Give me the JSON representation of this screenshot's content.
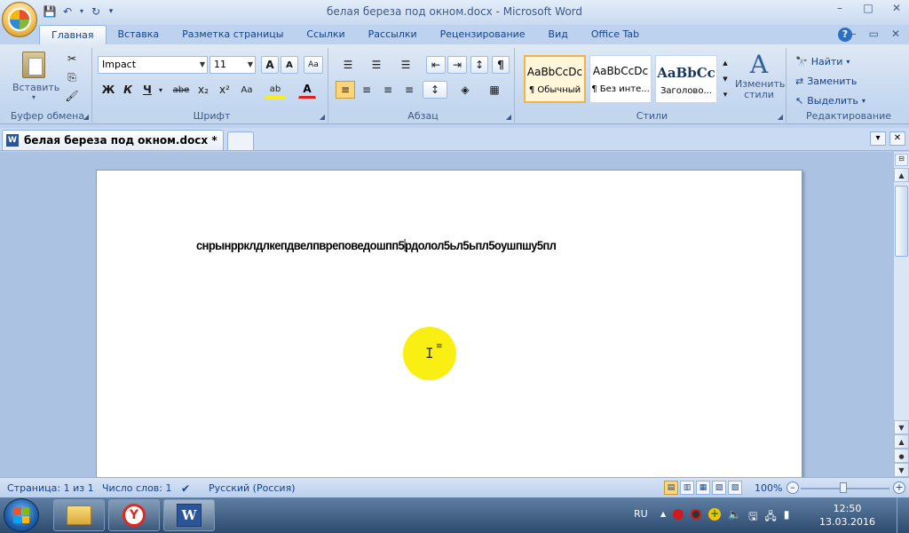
{
  "window": {
    "title": "белая береза под окном.docx - Microsoft Word",
    "controls": {
      "minimize": "–",
      "maximize": "□",
      "close": "✕"
    }
  },
  "qat": {
    "save_icon": "💾",
    "undo_icon": "↶",
    "undo_arrow": "▾",
    "redo_icon": "↻",
    "customize": "▾"
  },
  "ribbon": {
    "tabs": [
      "Главная",
      "Вставка",
      "Разметка страницы",
      "Ссылки",
      "Рассылки",
      "Рецензирование",
      "Вид",
      "Office Tab"
    ],
    "help": "?",
    "minimize_controls": {
      "min": "–",
      "restore": "▭",
      "close": "✕"
    },
    "clipboard": {
      "label": "Буфер обмена",
      "paste": "Вставить",
      "paste_arrow": "▾",
      "cut_icon": "✂",
      "copy_icon": "⎘",
      "format_painter_icon": "🖌"
    },
    "font": {
      "label": "Шрифт",
      "font_name": "Impact",
      "font_size": "11",
      "grow": "A",
      "shrink": "A",
      "clear": "Aa",
      "bold": "Ж",
      "italic": "К",
      "underline": "Ч",
      "underline_arrow": "▾",
      "strike": "abe",
      "subscript": "x₂",
      "superscript": "x²",
      "case": "Aa",
      "highlight": "ab",
      "font_color": "A"
    },
    "paragraph": {
      "label": "Абзац",
      "bullets": "☰",
      "numbering": "☰",
      "multilevel": "☰",
      "decrease_indent": "⇤",
      "increase_indent": "⇥",
      "sort": "↕",
      "pilcrow": "¶",
      "align_left": "≡",
      "align_center": "≡",
      "align_right": "≡",
      "justify": "≡",
      "line_spacing": "↕",
      "shading": "◈",
      "borders": "▦"
    },
    "styles": {
      "label": "Стили",
      "items": [
        {
          "sample": "AaBbCcDc",
          "name": "¶ Обычный"
        },
        {
          "sample": "AaBbCcDc",
          "name": "¶ Без инте..."
        },
        {
          "sample": "AaBbCc",
          "name": "Заголово..."
        }
      ],
      "change_styles": "Изменить стили",
      "change_styles_icon": "A",
      "scroll_up": "▲",
      "scroll_down": "▼",
      "more": "▾"
    },
    "editing": {
      "label": "Редактирование",
      "find": "Найти",
      "find_arrow": "▾",
      "replace": "Заменить",
      "select": "Выделить",
      "select_arrow": "▾"
    }
  },
  "doc_tabs": {
    "active": "белая береза под окном.docx *",
    "word_icon": "W",
    "list_arrow": "▾",
    "close": "✕"
  },
  "document": {
    "text_before": "снрынррклдлкепдвелпвреповедошпп5",
    "text_after": "рдолол5ьл5ьпл5оушпшу5пл",
    "ibeam": "I",
    "paragraph_indicator": "≡"
  },
  "scrollbar": {
    "up": "▲",
    "down": "▼",
    "ruler": "⊟",
    "select_browse": "●",
    "prev_page": "▲",
    "next_page": "▼"
  },
  "status": {
    "page": "Страница: 1 из 1",
    "words": "Число слов: 1",
    "spell_icon": "✔",
    "language": "Русский (Россия)",
    "zoom": "100%",
    "zoom_minus": "–",
    "zoom_plus": "+",
    "views": [
      "▤",
      "▥",
      "▦",
      "▧",
      "▨"
    ]
  },
  "taskbar": {
    "language": "RU",
    "tray_arrow": "▲",
    "time": "12:50",
    "date": "13.03.2016",
    "yandex": "Y",
    "word": "W"
  },
  "colors": {
    "accent": "#15428b",
    "highlight": "#f9ef13",
    "word_blue": "#2a5699"
  }
}
